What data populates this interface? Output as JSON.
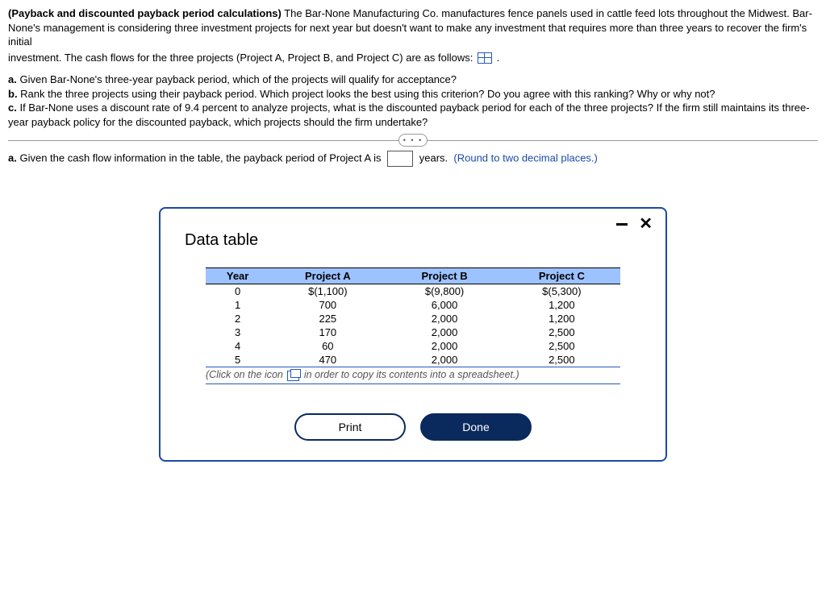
{
  "problem": {
    "title_bold": "(Payback and discounted payback period calculations)",
    "intro_rest": " The Bar-None Manufacturing Co. manufactures fence panels used in cattle feed lots throughout the Midwest. Bar-None's management is considering three investment projects for next year but doesn't want to make any investment that requires more than three years to recover the firm's initial",
    "intro_line2_pre": "investment.  The cash flows for the three projects (Project A, Project B, and Project C) are as follows: ",
    "intro_line2_post": " ."
  },
  "questions": {
    "a": "Given Bar-None's three-year payback period, which of the projects will qualify for acceptance?",
    "b": "Rank the three projects using their payback period.  Which project looks the best using this criterion?  Do you agree with this ranking?  Why or why not?",
    "c": "If Bar-None uses a discount rate of 9.4 percent to analyze projects, what is the discounted payback period for each of the three projects?  If the firm still maintains its three-year payback policy for the discounted payback, which projects should the firm undertake?"
  },
  "pill": "• • •",
  "answer": {
    "label_a": "a.",
    "pre": "Given the cash flow information in the table, the payback period of Project A is",
    "post": "years.",
    "hint": "(Round to two decimal places.)"
  },
  "modal": {
    "title": "Data table",
    "headers": {
      "year": "Year",
      "a": "Project A",
      "b": "Project B",
      "c": "Project C"
    },
    "rows": [
      {
        "year": "0",
        "a": "$(1,100)",
        "b": "$(9,800)",
        "c": "$(5,300)"
      },
      {
        "year": "1",
        "a": "700",
        "b": "6,000",
        "c": "1,200"
      },
      {
        "year": "2",
        "a": "225",
        "b": "2,000",
        "c": "1,200"
      },
      {
        "year": "3",
        "a": "170",
        "b": "2,000",
        "c": "2,500"
      },
      {
        "year": "4",
        "a": "60",
        "b": "2,000",
        "c": "2,500"
      },
      {
        "year": "5",
        "a": "470",
        "b": "2,000",
        "c": "2,500"
      }
    ],
    "note_pre": "(Click on the icon ",
    "note_post": " in order to copy its contents into a spreadsheet.)",
    "print": "Print",
    "done": "Done"
  }
}
